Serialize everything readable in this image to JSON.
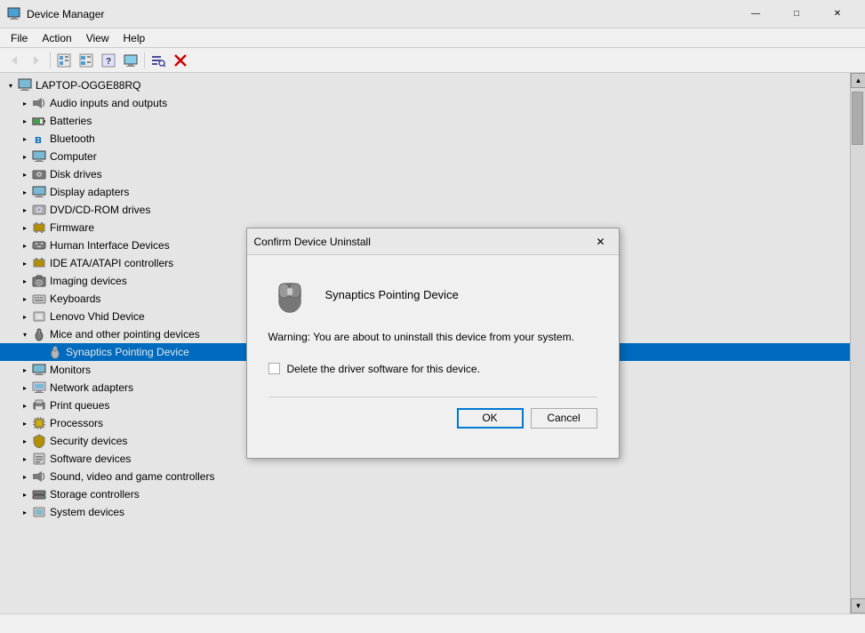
{
  "window": {
    "title": "Device Manager",
    "icon": "🖥️"
  },
  "titlebar": {
    "minimize_label": "—",
    "maximize_label": "□",
    "close_label": "✕"
  },
  "menubar": {
    "items": [
      {
        "id": "file",
        "label": "File"
      },
      {
        "id": "action",
        "label": "Action"
      },
      {
        "id": "view",
        "label": "View"
      },
      {
        "id": "help",
        "label": "Help"
      }
    ]
  },
  "toolbar": {
    "buttons": [
      {
        "id": "back",
        "icon": "◀",
        "label": "Back",
        "disabled": true
      },
      {
        "id": "forward",
        "icon": "▶",
        "label": "Forward",
        "disabled": true
      },
      {
        "id": "tree",
        "icon": "⊞",
        "label": "Tree"
      },
      {
        "id": "list",
        "icon": "☰",
        "label": "List"
      },
      {
        "id": "help",
        "icon": "?",
        "label": "Help"
      },
      {
        "id": "monitor",
        "icon": "🖥",
        "label": "Monitor"
      },
      {
        "id": "search",
        "icon": "🔍",
        "label": "Search"
      },
      {
        "id": "remove",
        "icon": "✕",
        "label": "Remove",
        "color": "red"
      }
    ]
  },
  "tree": {
    "root": {
      "label": "LAPTOP-OGGE88RQ",
      "expanded": true
    },
    "items": [
      {
        "id": "audio",
        "label": "Audio inputs and outputs",
        "icon": "🔊",
        "indent": 1,
        "expanded": false
      },
      {
        "id": "batteries",
        "label": "Batteries",
        "icon": "🔋",
        "indent": 1,
        "expanded": false
      },
      {
        "id": "bluetooth",
        "label": "Bluetooth",
        "icon": "📶",
        "indent": 1,
        "expanded": false
      },
      {
        "id": "computer",
        "label": "Computer",
        "icon": "💻",
        "indent": 1,
        "expanded": false
      },
      {
        "id": "disk",
        "label": "Disk drives",
        "icon": "💾",
        "indent": 1,
        "expanded": false
      },
      {
        "id": "display",
        "label": "Display adapters",
        "icon": "🖥",
        "indent": 1,
        "expanded": false
      },
      {
        "id": "dvd",
        "label": "DVD/CD-ROM drives",
        "icon": "💿",
        "indent": 1,
        "expanded": false
      },
      {
        "id": "firmware",
        "label": "Firmware",
        "icon": "⚙",
        "indent": 1,
        "expanded": false
      },
      {
        "id": "hid",
        "label": "Human Interface Devices",
        "icon": "🖱",
        "indent": 1,
        "expanded": false
      },
      {
        "id": "ide",
        "label": "IDE ATA/ATAPI controllers",
        "icon": "🔌",
        "indent": 1,
        "expanded": false
      },
      {
        "id": "imaging",
        "label": "Imaging devices",
        "icon": "📷",
        "indent": 1,
        "expanded": false
      },
      {
        "id": "keyboards",
        "label": "Keyboards",
        "icon": "⌨",
        "indent": 1,
        "expanded": false
      },
      {
        "id": "lenovo",
        "label": "Lenovo Vhid Device",
        "icon": "📋",
        "indent": 1,
        "expanded": false
      },
      {
        "id": "mice",
        "label": "Mice and other pointing devices",
        "icon": "🖱",
        "indent": 1,
        "expanded": true
      },
      {
        "id": "synaptics",
        "label": "Synaptics Pointing Device",
        "icon": "🖱",
        "indent": 2,
        "expanded": false,
        "selected": true
      },
      {
        "id": "monitors",
        "label": "Monitors",
        "icon": "🖥",
        "indent": 1,
        "expanded": false
      },
      {
        "id": "network",
        "label": "Network adapters",
        "icon": "🌐",
        "indent": 1,
        "expanded": false
      },
      {
        "id": "print",
        "label": "Print queues",
        "icon": "🖨",
        "indent": 1,
        "expanded": false
      },
      {
        "id": "processors",
        "label": "Processors",
        "icon": "⚡",
        "indent": 1,
        "expanded": false
      },
      {
        "id": "security",
        "label": "Security devices",
        "icon": "🔒",
        "indent": 1,
        "expanded": false
      },
      {
        "id": "software",
        "label": "Software devices",
        "icon": "📦",
        "indent": 1,
        "expanded": false
      },
      {
        "id": "sound",
        "label": "Sound, video and game controllers",
        "icon": "🎵",
        "indent": 1,
        "expanded": false
      },
      {
        "id": "storage",
        "label": "Storage controllers",
        "icon": "💾",
        "indent": 1,
        "expanded": false
      },
      {
        "id": "system",
        "label": "System devices",
        "icon": "⚙",
        "indent": 1,
        "expanded": false
      }
    ]
  },
  "modal": {
    "title": "Confirm Device Uninstall",
    "device_name": "Synaptics Pointing Device",
    "warning_text": "Warning: You are about to uninstall this device from your system.",
    "checkbox_label": "Delete the driver software for this device.",
    "checkbox_checked": false,
    "ok_label": "OK",
    "cancel_label": "Cancel"
  },
  "statusbar": {
    "text": ""
  }
}
